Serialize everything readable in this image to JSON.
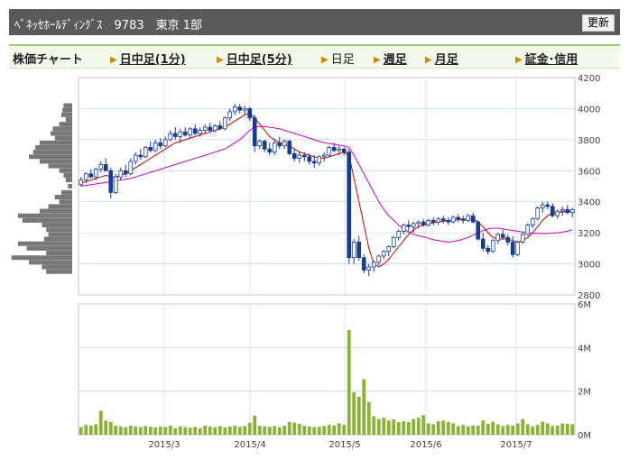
{
  "header": {
    "title": "ﾍﾞﾈｯｾﾎｰﾙﾃﾞｨﾝｸﾞｽ　9783　東京 1部",
    "refresh_label": "更新"
  },
  "nav": {
    "title": "株価チャート",
    "items": [
      {
        "label": "日中足(1分)",
        "link": true
      },
      {
        "label": "日中足(5分)",
        "link": true
      },
      {
        "label": "日足",
        "link": false
      },
      {
        "label": "週足",
        "link": true
      },
      {
        "label": "月足",
        "link": true
      },
      {
        "label": "証金･信用",
        "link": true
      }
    ]
  },
  "colors": {
    "candle_up": "#ffffff",
    "candle_down": "#1a3a8c",
    "ma_short": "#cc0000",
    "ma_long": "#cc00cc",
    "volume": "#8db03a",
    "price_profile": "#777777",
    "grid": "#b8d0e8"
  },
  "chart_data": [
    {
      "type": "candlestick",
      "ylim": [
        2800,
        4200
      ],
      "y_ticks": [
        "4200",
        "4000",
        "3800",
        "3600",
        "3400",
        "3200",
        "3000",
        "2800"
      ],
      "x_ticks": [
        "2015/3",
        "2015/4",
        "2015/5",
        "2015/6",
        "2015/7"
      ],
      "ohlc": [
        [
          3510,
          3560,
          3500,
          3540
        ],
        [
          3540,
          3590,
          3520,
          3580
        ],
        [
          3580,
          3610,
          3550,
          3560
        ],
        [
          3560,
          3620,
          3540,
          3610
        ],
        [
          3610,
          3660,
          3590,
          3640
        ],
        [
          3640,
          3680,
          3600,
          3600
        ],
        [
          3600,
          3620,
          3420,
          3460
        ],
        [
          3460,
          3580,
          3450,
          3560
        ],
        [
          3560,
          3620,
          3540,
          3600
        ],
        [
          3600,
          3640,
          3560,
          3580
        ],
        [
          3580,
          3680,
          3570,
          3660
        ],
        [
          3660,
          3720,
          3640,
          3700
        ],
        [
          3700,
          3740,
          3670,
          3690
        ],
        [
          3690,
          3760,
          3680,
          3750
        ],
        [
          3750,
          3790,
          3720,
          3730
        ],
        [
          3730,
          3800,
          3720,
          3780
        ],
        [
          3780,
          3810,
          3740,
          3760
        ],
        [
          3760,
          3820,
          3750,
          3800
        ],
        [
          3800,
          3860,
          3790,
          3840
        ],
        [
          3840,
          3880,
          3800,
          3820
        ],
        [
          3820,
          3870,
          3780,
          3850
        ],
        [
          3850,
          3880,
          3820,
          3830
        ],
        [
          3830,
          3880,
          3810,
          3870
        ],
        [
          3870,
          3900,
          3830,
          3840
        ],
        [
          3840,
          3880,
          3820,
          3860
        ],
        [
          3860,
          3900,
          3840,
          3880
        ],
        [
          3880,
          3910,
          3850,
          3860
        ],
        [
          3860,
          3900,
          3850,
          3890
        ],
        [
          3890,
          3920,
          3860,
          3870
        ],
        [
          3870,
          3950,
          3860,
          3940
        ],
        [
          3940,
          4000,
          3920,
          3980
        ],
        [
          3980,
          4030,
          3960,
          4010
        ],
        [
          4010,
          4030,
          3970,
          3990
        ],
        [
          3990,
          4020,
          3960,
          4000
        ],
        [
          4000,
          4010,
          3920,
          3940
        ],
        [
          3940,
          3960,
          3720,
          3760
        ],
        [
          3760,
          3800,
          3740,
          3790
        ],
        [
          3790,
          3800,
          3720,
          3740
        ],
        [
          3740,
          3780,
          3700,
          3720
        ],
        [
          3720,
          3800,
          3700,
          3780
        ],
        [
          3780,
          3820,
          3740,
          3760
        ],
        [
          3760,
          3800,
          3740,
          3790
        ],
        [
          3790,
          3800,
          3700,
          3710
        ],
        [
          3710,
          3740,
          3660,
          3680
        ],
        [
          3680,
          3720,
          3650,
          3700
        ],
        [
          3700,
          3720,
          3660,
          3690
        ],
        [
          3690,
          3710,
          3640,
          3660
        ],
        [
          3660,
          3700,
          3620,
          3650
        ],
        [
          3650,
          3700,
          3630,
          3690
        ],
        [
          3690,
          3720,
          3660,
          3700
        ],
        [
          3700,
          3760,
          3690,
          3750
        ],
        [
          3750,
          3780,
          3720,
          3730
        ],
        [
          3730,
          3760,
          3700,
          3740
        ],
        [
          3740,
          3750,
          3700,
          3720
        ],
        [
          3720,
          3740,
          3000,
          3040
        ],
        [
          3040,
          3160,
          3000,
          3140
        ],
        [
          3140,
          3180,
          3020,
          3040
        ],
        [
          3040,
          3060,
          2940,
          2960
        ],
        [
          2960,
          3000,
          2920,
          2980
        ],
        [
          2980,
          3020,
          2950,
          3010
        ],
        [
          3010,
          3060,
          2990,
          3050
        ],
        [
          3050,
          3090,
          3030,
          3080
        ],
        [
          3080,
          3120,
          3050,
          3110
        ],
        [
          3110,
          3180,
          3100,
          3170
        ],
        [
          3170,
          3220,
          3150,
          3210
        ],
        [
          3210,
          3260,
          3190,
          3250
        ],
        [
          3250,
          3280,
          3210,
          3240
        ],
        [
          3240,
          3270,
          3200,
          3260
        ],
        [
          3260,
          3280,
          3230,
          3270
        ],
        [
          3270,
          3290,
          3240,
          3250
        ],
        [
          3250,
          3290,
          3240,
          3280
        ],
        [
          3280,
          3300,
          3250,
          3270
        ],
        [
          3270,
          3300,
          3250,
          3290
        ],
        [
          3290,
          3310,
          3260,
          3280
        ],
        [
          3280,
          3300,
          3250,
          3270
        ],
        [
          3270,
          3310,
          3260,
          3300
        ],
        [
          3300,
          3320,
          3270,
          3290
        ],
        [
          3290,
          3310,
          3260,
          3280
        ],
        [
          3280,
          3320,
          3270,
          3310
        ],
        [
          3310,
          3330,
          3260,
          3270
        ],
        [
          3270,
          3280,
          3150,
          3160
        ],
        [
          3160,
          3200,
          3080,
          3100
        ],
        [
          3100,
          3120,
          3060,
          3080
        ],
        [
          3080,
          3160,
          3070,
          3150
        ],
        [
          3150,
          3200,
          3130,
          3190
        ],
        [
          3190,
          3220,
          3160,
          3170
        ],
        [
          3170,
          3190,
          3120,
          3140
        ],
        [
          3140,
          3180,
          3040,
          3060
        ],
        [
          3060,
          3150,
          3050,
          3140
        ],
        [
          3140,
          3200,
          3130,
          3190
        ],
        [
          3190,
          3260,
          3180,
          3250
        ],
        [
          3250,
          3300,
          3230,
          3290
        ],
        [
          3290,
          3370,
          3280,
          3360
        ],
        [
          3360,
          3400,
          3330,
          3380
        ],
        [
          3380,
          3400,
          3350,
          3370
        ],
        [
          3370,
          3390,
          3300,
          3310
        ],
        [
          3310,
          3350,
          3290,
          3340
        ],
        [
          3340,
          3370,
          3310,
          3350
        ],
        [
          3350,
          3380,
          3320,
          3330
        ],
        [
          3330,
          3360,
          3300,
          3350
        ]
      ],
      "ma_short": [
        3520,
        3530,
        3540,
        3550,
        3560,
        3570,
        3560,
        3560,
        3570,
        3580,
        3600,
        3620,
        3640,
        3660,
        3680,
        3700,
        3720,
        3740,
        3760,
        3780,
        3790,
        3800,
        3810,
        3820,
        3830,
        3840,
        3850,
        3860,
        3870,
        3880,
        3900,
        3920,
        3940,
        3960,
        3970,
        3940,
        3900,
        3860,
        3820,
        3800,
        3780,
        3770,
        3760,
        3740,
        3720,
        3710,
        3700,
        3690,
        3680,
        3680,
        3690,
        3700,
        3710,
        3720,
        3700,
        3550,
        3400,
        3250,
        3100,
        3000,
        2980,
        3000,
        3030,
        3070,
        3110,
        3150,
        3190,
        3220,
        3240,
        3250,
        3260,
        3265,
        3270,
        3275,
        3280,
        3280,
        3285,
        3285,
        3290,
        3290,
        3270,
        3240,
        3200,
        3170,
        3160,
        3160,
        3160,
        3150,
        3140,
        3150,
        3170,
        3200,
        3240,
        3280,
        3310,
        3330,
        3330,
        3335,
        3335,
        3340
      ],
      "ma_long": [
        3500,
        3505,
        3510,
        3515,
        3520,
        3525,
        3530,
        3535,
        3540,
        3545,
        3550,
        3560,
        3570,
        3580,
        3590,
        3600,
        3610,
        3620,
        3630,
        3640,
        3650,
        3660,
        3670,
        3680,
        3690,
        3700,
        3710,
        3720,
        3730,
        3740,
        3760,
        3780,
        3800,
        3830,
        3860,
        3880,
        3885,
        3885,
        3880,
        3875,
        3870,
        3860,
        3850,
        3840,
        3830,
        3820,
        3810,
        3800,
        3790,
        3780,
        3775,
        3770,
        3765,
        3760,
        3750,
        3700,
        3640,
        3580,
        3520,
        3460,
        3400,
        3350,
        3310,
        3280,
        3250,
        3225,
        3205,
        3190,
        3180,
        3175,
        3165,
        3155,
        3150,
        3145,
        3140,
        3145,
        3150,
        3160,
        3170,
        3185,
        3200,
        3215,
        3225,
        3230,
        3230,
        3225,
        3220,
        3215,
        3210,
        3205,
        3200,
        3198,
        3196,
        3195,
        3196,
        3198,
        3200,
        3205,
        3210,
        3220
      ],
      "price_profile": [
        {
          "price": 4020,
          "len": 8
        },
        {
          "price": 3990,
          "len": 9
        },
        {
          "price": 3960,
          "len": 10
        },
        {
          "price": 3930,
          "len": 6
        },
        {
          "price": 3900,
          "len": 12
        },
        {
          "price": 3870,
          "len": 18
        },
        {
          "price": 3840,
          "len": 20
        },
        {
          "price": 3810,
          "len": 16
        },
        {
          "price": 3780,
          "len": 30
        },
        {
          "price": 3750,
          "len": 34
        },
        {
          "price": 3720,
          "len": 36
        },
        {
          "price": 3690,
          "len": 40
        },
        {
          "price": 3660,
          "len": 30
        },
        {
          "price": 3630,
          "len": 22
        },
        {
          "price": 3600,
          "len": 12
        },
        {
          "price": 3570,
          "len": 8
        },
        {
          "price": 3540,
          "len": 6
        },
        {
          "price": 3500,
          "len": 4
        },
        {
          "price": 3460,
          "len": 10
        },
        {
          "price": 3430,
          "len": 16
        },
        {
          "price": 3400,
          "len": 12
        },
        {
          "price": 3370,
          "len": 22
        },
        {
          "price": 3340,
          "len": 30
        },
        {
          "price": 3310,
          "len": 50
        },
        {
          "price": 3280,
          "len": 46
        },
        {
          "price": 3250,
          "len": 28
        },
        {
          "price": 3220,
          "len": 24
        },
        {
          "price": 3190,
          "len": 22
        },
        {
          "price": 3160,
          "len": 26
        },
        {
          "price": 3130,
          "len": 50
        },
        {
          "price": 3100,
          "len": 42
        },
        {
          "price": 3070,
          "len": 24
        },
        {
          "price": 3040,
          "len": 56
        },
        {
          "price": 3010,
          "len": 40
        },
        {
          "price": 2980,
          "len": 28
        },
        {
          "price": 2950,
          "len": 24
        }
      ]
    },
    {
      "type": "bar",
      "ylim": [
        0,
        6000000
      ],
      "y_ticks": [
        "6M",
        "4M",
        "2M",
        "0M"
      ],
      "values": [
        350000,
        450000,
        420000,
        480000,
        1100000,
        650000,
        580000,
        420000,
        380000,
        350000,
        420000,
        380000,
        350000,
        400000,
        360000,
        330000,
        380000,
        350000,
        420000,
        300000,
        380000,
        350000,
        320000,
        360000,
        300000,
        420000,
        380000,
        350000,
        400000,
        330000,
        380000,
        420000,
        360000,
        400000,
        550000,
        880000,
        420000,
        380000,
        360000,
        400000,
        350000,
        420000,
        580000,
        560000,
        500000,
        420000,
        380000,
        350000,
        360000,
        400000,
        450000,
        420000,
        520000,
        450000,
        4800000,
        1950000,
        1750000,
        2550000,
        1500000,
        850000,
        720000,
        780000,
        650000,
        700000,
        580000,
        620000,
        580000,
        720000,
        780000,
        900000,
        520000,
        480000,
        620000,
        650000,
        580000,
        520000,
        400000,
        450000,
        380000,
        420000,
        420000,
        650000,
        500000,
        600000,
        480000,
        400000,
        450000,
        420000,
        520000,
        720000,
        480000,
        380000,
        450000,
        600000,
        520000,
        400000,
        420000,
        520000,
        500000,
        480000
      ]
    }
  ]
}
